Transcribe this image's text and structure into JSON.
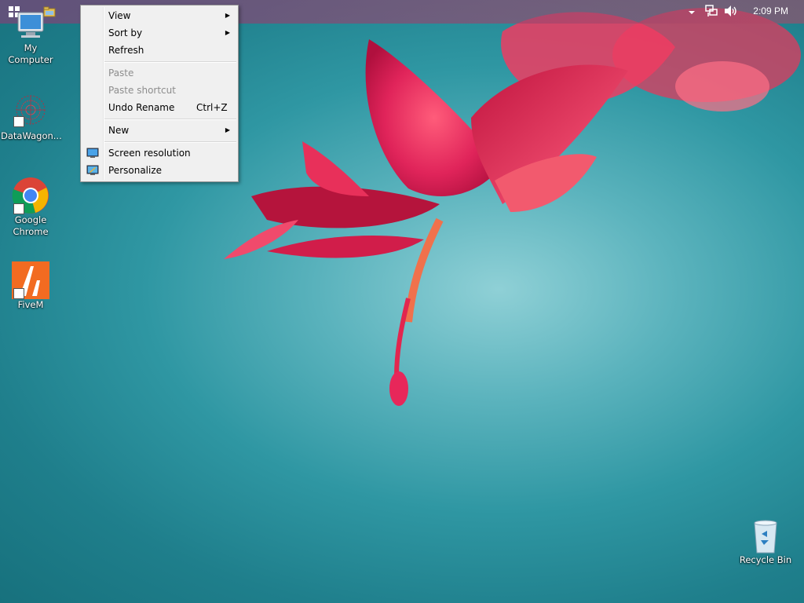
{
  "desktop": {
    "icons": [
      {
        "label": "My Computer"
      },
      {
        "label": "DataWagon..."
      },
      {
        "label": "Google\nChrome"
      },
      {
        "label": "FiveM"
      },
      {
        "label": "Recycle Bin"
      }
    ]
  },
  "taskbar": {
    "start_icon": "windows-logo-icon",
    "quick_launch_icon": "file-explorer-icon",
    "tray_icons": [
      "chevron-up-icon",
      "network-icon",
      "volume-icon"
    ],
    "clock": "2:09 PM"
  },
  "context_menu": {
    "items": [
      {
        "label": "View",
        "submenu": true,
        "enabled": true
      },
      {
        "label": "Sort by",
        "submenu": true,
        "enabled": true
      },
      {
        "label": "Refresh",
        "enabled": true
      },
      {
        "label": "Paste",
        "enabled": false
      },
      {
        "label": "Paste shortcut",
        "enabled": false
      },
      {
        "label": "Undo Rename",
        "shortcut": "Ctrl+Z",
        "enabled": true
      },
      {
        "label": "New",
        "submenu": true,
        "enabled": true
      },
      {
        "label": "Screen resolution",
        "icon": "monitor-icon",
        "enabled": true
      },
      {
        "label": "Personalize",
        "icon": "personalize-icon",
        "enabled": true
      }
    ],
    "submenu_arrow": "▶"
  },
  "colors": {
    "wallpaper_teal": "#2f97a3",
    "flower_red": "#e0245a",
    "menu_bg": "#f0f0f0",
    "disabled_text": "#8d8d8d"
  }
}
